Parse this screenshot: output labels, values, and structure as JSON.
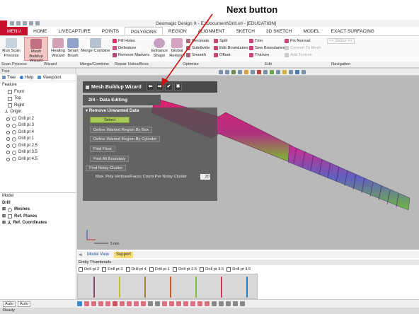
{
  "annotation": {
    "label": "Next button"
  },
  "window": {
    "title": "Geomagic Design X - E:\\Document\\Drill.xrl - [EDUCATION]"
  },
  "ribbon_tabs": [
    "MENU",
    "HOME",
    "LIVECAPTURE",
    "POINTS",
    "POLYGONS",
    "REGION",
    "ALIGNMENT",
    "SKETCH",
    "3D SKETCH",
    "MODEL",
    "EXACT SURFACING"
  ],
  "active_tab": "POLYGONS",
  "ribbon": {
    "run_scan": "Run Scan Process",
    "mesh_buildup": "Mesh Buildup Wizard",
    "healing": "Healing Wizard",
    "smart_brush": "Smart Brush",
    "merge_combine": "Merge Combine",
    "fill_holes": "Fill Holes",
    "defeature": "Defeature",
    "remove_markers": "Remove Markers",
    "enhance_shape": "Enhance Shape",
    "global_remesh": "Global Remesh",
    "decimate": "Decimate",
    "subdivide": "Subdivide",
    "smooth": "Smooth",
    "split": "Split",
    "edit_boundaries": "Edit Boundaries",
    "offset": "Offset",
    "trim": "Trim",
    "sew_boundaries": "Sew Boundaries",
    "thicken": "Thicken",
    "fix_normal": "Fix Normal",
    "convert_to_mesh": "Convert To Mesh",
    "add_texture": "Add Texture",
    "select_nav": "<< Select >>"
  },
  "ribbon_groups": [
    "Scan Process",
    "Wizard",
    "Merge/Combine",
    "Repair Holes/Boss",
    "Optimize",
    "Edit",
    "Navigation"
  ],
  "left_panel": {
    "header": "Tree",
    "tabs": [
      "Tree",
      "Help",
      "Viewpoint"
    ],
    "feature_label": "Feature",
    "features": [
      "Front",
      "Top",
      "Right",
      "Origin",
      "Drill pt 2",
      "Drill pt 3",
      "Drill pt 4",
      "Drill pt 1",
      "Drill pt 2.5",
      "Drill pt 3.5",
      "Drill pt 4.5"
    ],
    "model_label": "Model",
    "model_root": "Drill",
    "model_items": [
      "Meshes",
      "Ref. Planes",
      "Ref. Coordinates"
    ]
  },
  "wizard": {
    "title": "Mesh Buildup Wizard",
    "step": "2/4 - Data Editing",
    "section": "Remove Unwanted Data",
    "select_label": "Select",
    "buttons": [
      "Define Wanted Region By Box",
      "Define Wanted Region By Cylinder",
      "Find Floor",
      "Find All Boundary",
      "Find Noisy Cluster"
    ],
    "max_poly_label": "Max. Poly Vertices/Faces Count Per Noisy Cluster",
    "max_poly_value": "20"
  },
  "viewport": {
    "scale": "5 mm"
  },
  "bottom_tabs": [
    "Model View",
    "Support"
  ],
  "entity_thumbnails": {
    "header": "Entity Thumbnails",
    "items": [
      "Drill pt 2",
      "Drill pt 3",
      "Drill pt 4",
      "Drill pt 1",
      "Drill pt 2.5",
      "Drill pt 3.5",
      "Drill pt 4.5"
    ]
  },
  "bottom_toolbar": {
    "auto1": "Auto",
    "auto2": "Auto"
  },
  "status": "Ready",
  "colors": {
    "accent": "#c8102e",
    "drill_magenta": "#e0206e",
    "drill_green": "#7bbf30",
    "support_tab": "#f7dc6f"
  }
}
